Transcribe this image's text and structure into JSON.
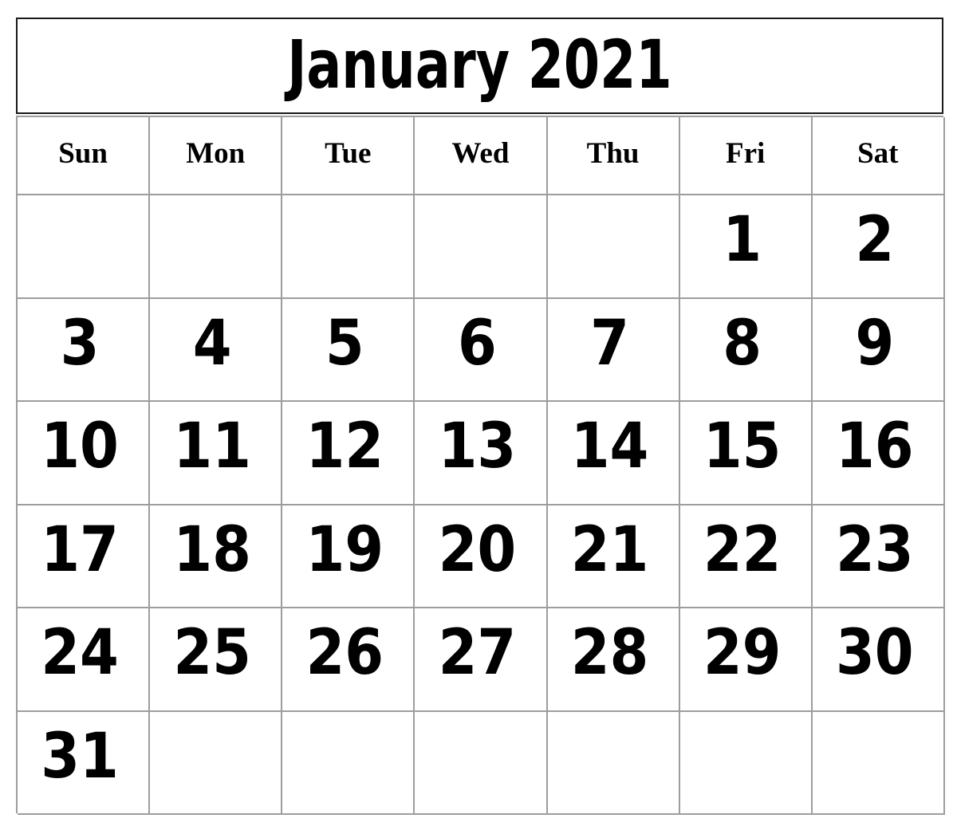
{
  "calendar": {
    "title": "January 2021",
    "month": "January",
    "year": "2021",
    "first_day_of_week": "Sun",
    "weekdays": [
      {
        "label": "Sun"
      },
      {
        "label": "Mon"
      },
      {
        "label": "Tue"
      },
      {
        "label": "Wed"
      },
      {
        "label": "Thu"
      },
      {
        "label": "Fri"
      },
      {
        "label": "Sat"
      }
    ],
    "weeks": [
      {
        "days": [
          {
            "num": ""
          },
          {
            "num": ""
          },
          {
            "num": ""
          },
          {
            "num": ""
          },
          {
            "num": ""
          },
          {
            "num": "1"
          },
          {
            "num": "2"
          }
        ]
      },
      {
        "days": [
          {
            "num": "3"
          },
          {
            "num": "4"
          },
          {
            "num": "5"
          },
          {
            "num": "6"
          },
          {
            "num": "7"
          },
          {
            "num": "8"
          },
          {
            "num": "9"
          }
        ]
      },
      {
        "days": [
          {
            "num": "10"
          },
          {
            "num": "11"
          },
          {
            "num": "12"
          },
          {
            "num": "13"
          },
          {
            "num": "14"
          },
          {
            "num": "15"
          },
          {
            "num": "16"
          }
        ]
      },
      {
        "days": [
          {
            "num": "17"
          },
          {
            "num": "18"
          },
          {
            "num": "19"
          },
          {
            "num": "20"
          },
          {
            "num": "21"
          },
          {
            "num": "22"
          },
          {
            "num": "23"
          }
        ]
      },
      {
        "days": [
          {
            "num": "24"
          },
          {
            "num": "25"
          },
          {
            "num": "26"
          },
          {
            "num": "27"
          },
          {
            "num": "28"
          },
          {
            "num": "29"
          },
          {
            "num": "30"
          }
        ]
      },
      {
        "days": [
          {
            "num": "31"
          },
          {
            "num": ""
          },
          {
            "num": ""
          },
          {
            "num": ""
          },
          {
            "num": ""
          },
          {
            "num": ""
          },
          {
            "num": ""
          }
        ]
      }
    ],
    "colors": {
      "page_background": "#ffffff",
      "title_border": "#1a1a1a",
      "grid_line": "#9d9d9d",
      "text": "#000000"
    }
  }
}
